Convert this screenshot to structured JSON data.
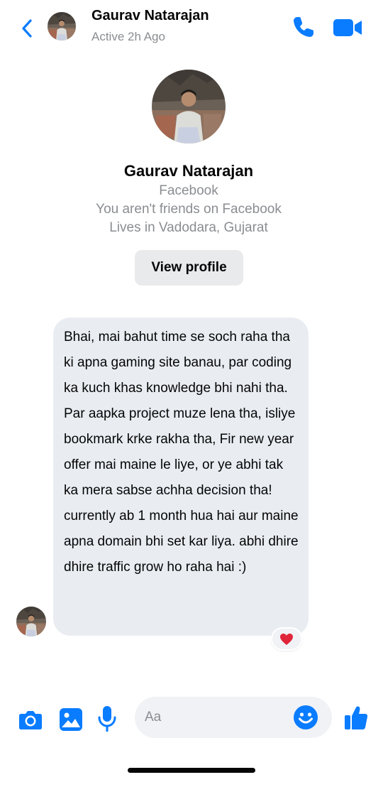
{
  "header": {
    "name": "Gaurav Natarajan",
    "status": "Active 2h Ago"
  },
  "profile": {
    "name": "Gaurav Natarajan",
    "platform": "Facebook",
    "friend_status": "You aren't friends on Facebook",
    "location": "Lives in Vadodara, Gujarat",
    "view_profile_label": "View profile"
  },
  "message": {
    "text": "Bhai, mai bahut time se soch raha tha ki apna gaming site banau, par coding ka kuch khas knowledge bhi nahi tha. Par aapka project muze lena tha, isliye bookmark krke rakha tha, Fir new year offer mai maine le liye, or ye abhi tak ka mera sabse achha decision tha! currently ab 1 month hua hai aur maine apna domain bhi set kar liya. abhi dhire dhire traffic grow ho raha hai :)",
    "reaction": "heart-emoji"
  },
  "composer": {
    "placeholder": "Aa",
    "icons": [
      "camera-icon",
      "gallery-icon",
      "microphone-icon",
      "emoji-icon",
      "thumbs-up-icon"
    ]
  },
  "colors": {
    "accent": "#0a7cff",
    "bubble": "#e9edf2",
    "muted_text": "#8a8d91",
    "button_bg": "#e9eaec",
    "heart": "#e0243a"
  }
}
